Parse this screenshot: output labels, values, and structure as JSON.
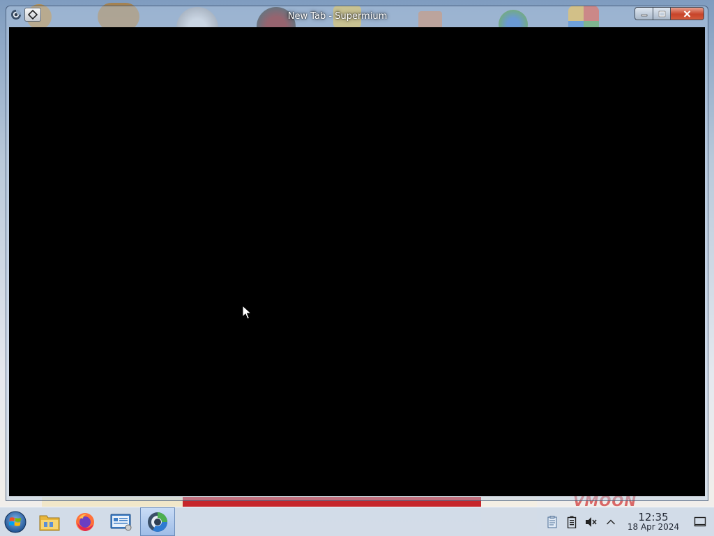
{
  "window": {
    "title": "New Tab - Supermium",
    "app_icon": "supermium-icon",
    "pin_icon": "diamond-pin-icon",
    "controls": {
      "minimize_icon": "minimize-icon",
      "maximize_icon": "maximize-icon",
      "close_icon": "close-icon"
    }
  },
  "wallpaper": {
    "logo_text": "VMOON"
  },
  "taskbar": {
    "start_icon": "windows-start-orb-icon",
    "pinned": [
      {
        "name": "file-explorer",
        "icon": "folder-icon"
      },
      {
        "name": "firefox",
        "icon": "firefox-icon"
      },
      {
        "name": "control-panel",
        "icon": "control-panel-icon"
      },
      {
        "name": "supermium",
        "icon": "supermium-icon",
        "active": true
      }
    ],
    "tray": {
      "icons": [
        "clipboard-notes-icon",
        "battery-icon",
        "speaker-muted-icon",
        "chevron-up-icon"
      ],
      "time": "12:35",
      "date": "18 Apr 2024",
      "show_desktop_icon": "notification-icon"
    }
  },
  "colors": {
    "content_background": "#000000",
    "close_button": "#c7442a",
    "taskbar": "#cdd8e8"
  }
}
